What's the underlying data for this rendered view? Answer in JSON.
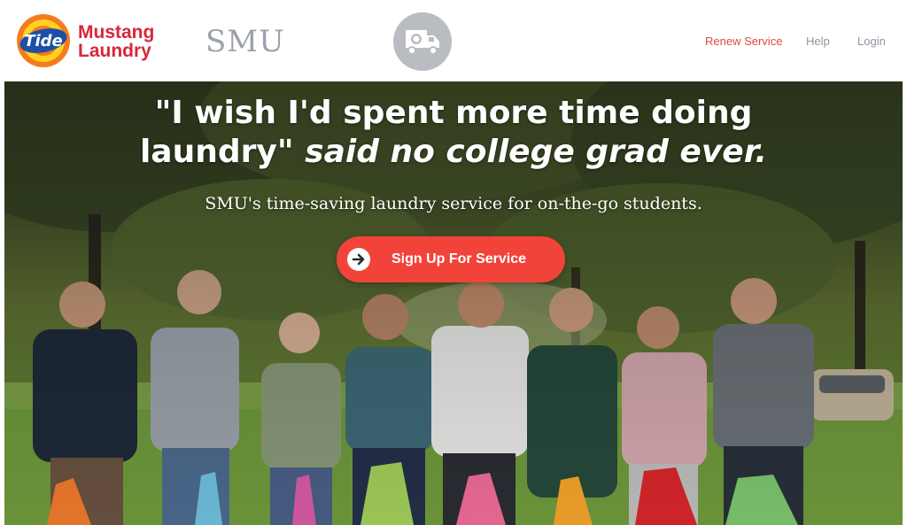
{
  "header": {
    "tide_logo_text": "Tide",
    "brand_line1": "Mustang",
    "brand_line2": "Laundry",
    "partner_logo": "SMU",
    "truck_icon": "delivery-truck-icon",
    "nav": {
      "renew": "Renew Service",
      "help": "Help",
      "login": "Login"
    }
  },
  "hero": {
    "headline_quote": "\"I wish I'd spent more time doing",
    "headline_quote_end": "laundry\"",
    "headline_italic": "said no college grad ever.",
    "subheadline": "SMU's time-saving laundry service for on-the-go students.",
    "cta_label": "Sign Up For Service",
    "cta_icon": "arrow-right-icon"
  },
  "colors": {
    "brand_red": "#d8263a",
    "cta_red": "#f2433a",
    "nav_gray": "#8d95a0",
    "nav_accent": "#e0483f"
  }
}
